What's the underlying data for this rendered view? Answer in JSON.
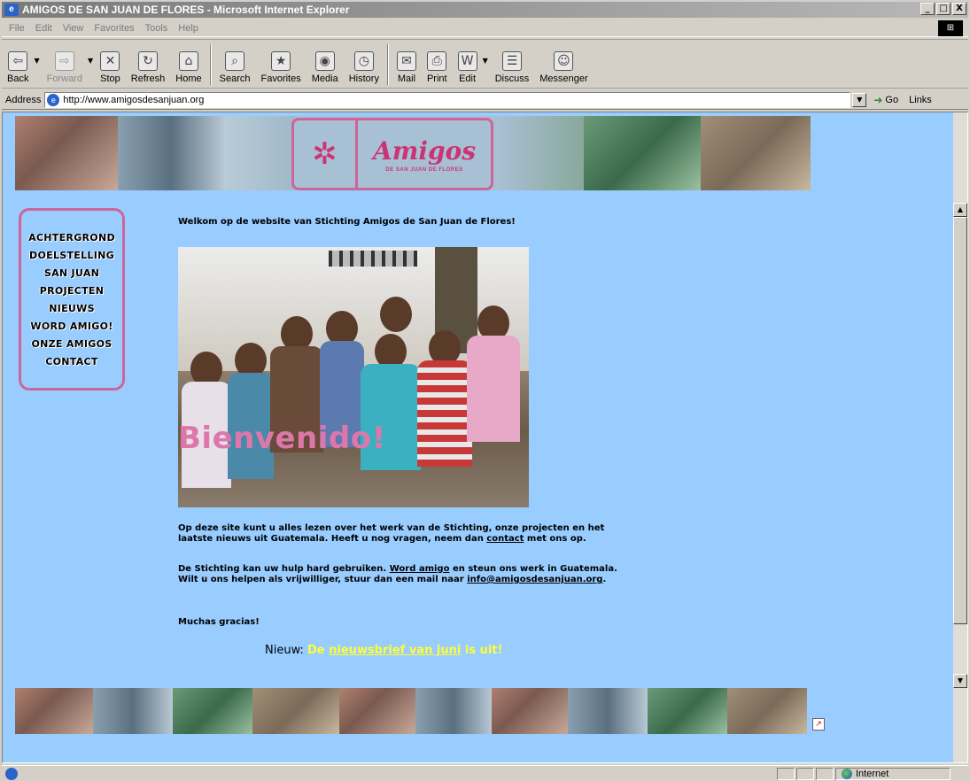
{
  "window": {
    "title": "AMIGOS DE SAN JUAN DE FLORES - Microsoft Internet Explorer",
    "minimize": "_",
    "maximize": "□",
    "close": "X"
  },
  "menu": [
    "File",
    "Edit",
    "View",
    "Favorites",
    "Tools",
    "Help"
  ],
  "toolbar": {
    "back": "Back",
    "forward": "Forward",
    "stop": "Stop",
    "refresh": "Refresh",
    "home": "Home",
    "search": "Search",
    "favorites": "Favorites",
    "media": "Media",
    "history": "History",
    "mail": "Mail",
    "print": "Print",
    "edit": "Edit",
    "discuss": "Discuss",
    "messenger": "Messenger"
  },
  "address": {
    "label": "Address",
    "url": "http://www.amigosdesanjuan.org",
    "go": "Go",
    "links": "Links"
  },
  "site": {
    "logo_main": "Amigos",
    "logo_sub": "DE SAN JUAN DE FLORES",
    "nav": [
      "ACHTERGROND",
      "DOELSTELLING",
      "SAN JUAN",
      "PROJECTEN",
      "NIEUWS",
      "WORD AMIGO!",
      "ONZE AMIGOS",
      "CONTACT"
    ],
    "welcome": "Welkom op de website van Stichting Amigos de San Juan de Flores!",
    "hero_text": "Bienvenido!",
    "p1_a": "Op deze site kunt u alles lezen over het werk van de Stichting, onze projecten en het laatste nieuws uit Guatemala. Heeft u nog vragen, neem dan ",
    "p1_link": "contact",
    "p1_b": " met ons op.",
    "p2_a": "De Stichting kan uw hulp hard gebruiken. ",
    "p2_link": "Word amigo",
    "p2_b": " en steun ons werk in Guatemala. Wilt u ons helpen als vrijwilliger, stuur dan een mail naar ",
    "p2_email": "info@amigosdesanjuan.org",
    "p2_c": ".",
    "p3": "Muchas gracias!",
    "news_label": "Nieuw: ",
    "news_pre": "De ",
    "news_link": "nieuwsbrief van juni",
    "news_post": " is uit!"
  },
  "status": {
    "zone": "Internet"
  },
  "colors": {
    "page_bg": "#99ccff",
    "accent_pink": "#cc6699",
    "news_yellow": "#ffff33"
  }
}
